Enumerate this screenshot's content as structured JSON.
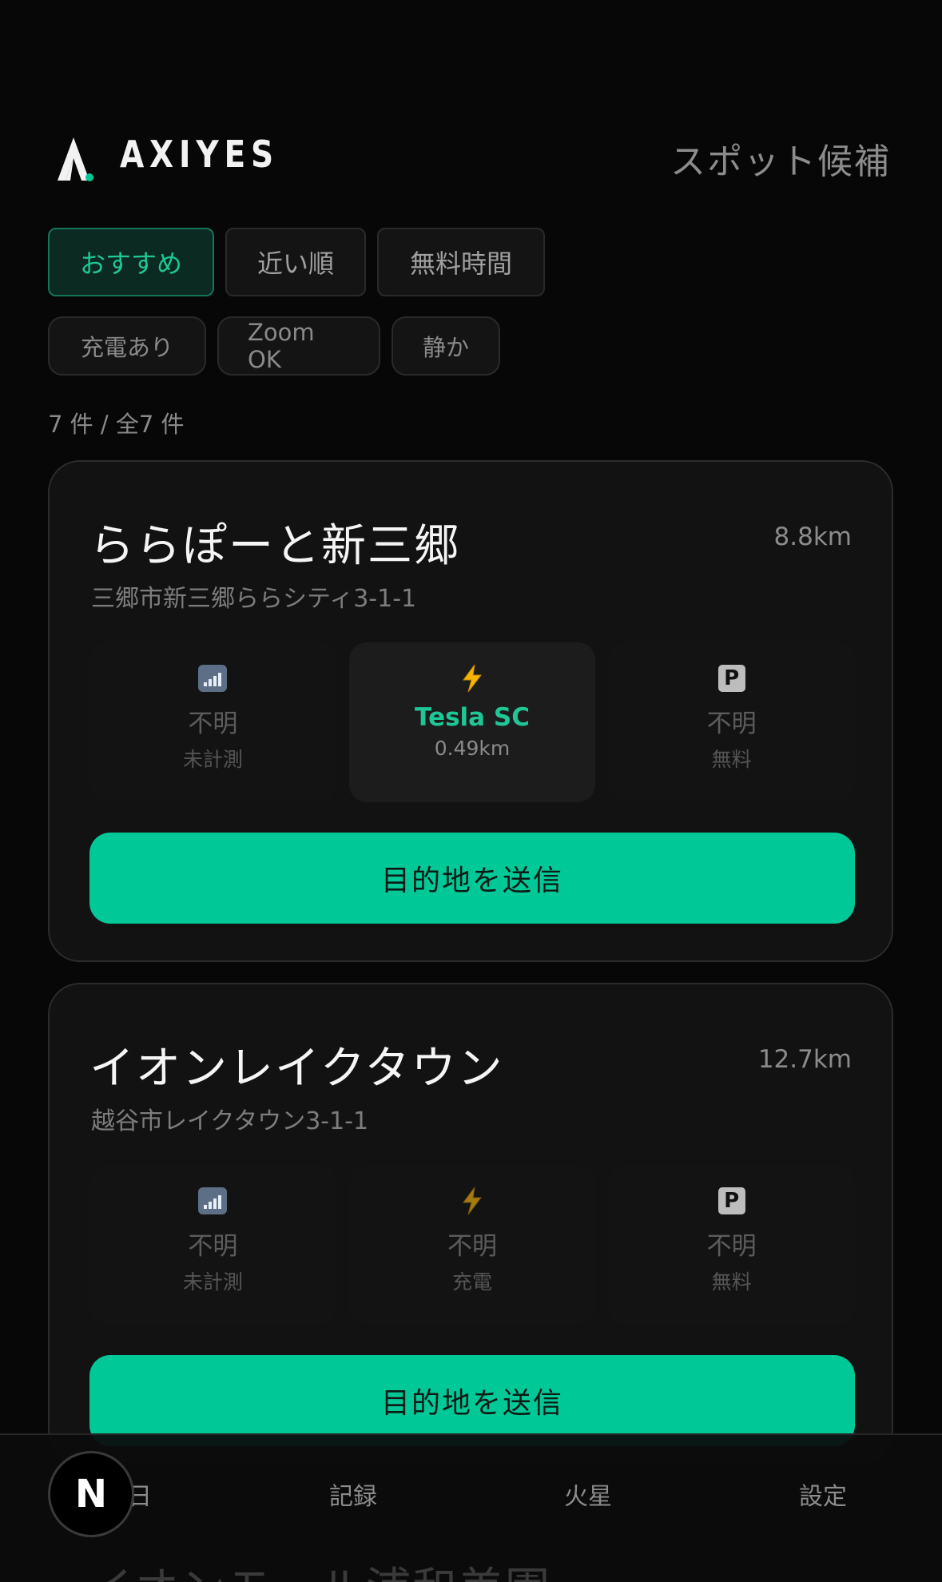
{
  "header": {
    "logo_text": "AXIYES",
    "title": "スポット候補"
  },
  "filters": {
    "row1": [
      "おすすめ",
      "近い順",
      "無料時間"
    ],
    "row2": [
      "充電あり",
      "Zoom OK",
      "静か"
    ],
    "selected": "おすすめ"
  },
  "count_label": "7 件 / 全7 件",
  "spots": [
    {
      "name": "ららぽーと新三郷",
      "distance": "8.8km",
      "address": "三郷市新三郷ららシティ3-1-1",
      "wifi": {
        "value": "不明",
        "sub": "未計測"
      },
      "charge": {
        "value": "Tesla SC",
        "sub": "0.49km"
      },
      "parking": {
        "value": "不明",
        "sub": "無料"
      },
      "button": "目的地を送信"
    },
    {
      "name": "イオンレイクタウン",
      "distance": "12.7km",
      "address": "越谷市レイクタウン3-1-1",
      "wifi": {
        "value": "不明",
        "sub": "未計測"
      },
      "charge": {
        "value": "不明",
        "sub": "充電"
      },
      "parking": {
        "value": "不明",
        "sub": "無料"
      },
      "button": "目的地を送信"
    }
  ],
  "peek_name": "イオンモール浦和美園",
  "nav": {
    "items": [
      "今日",
      "記録",
      "火星",
      "設定"
    ],
    "fab_label": "N"
  },
  "colors": {
    "accent": "#00c896",
    "background": "#070707",
    "card": "#121212"
  }
}
